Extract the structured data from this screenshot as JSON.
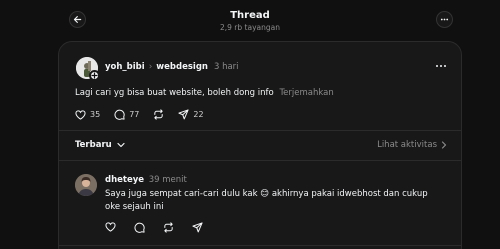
{
  "header": {
    "title": "Thread",
    "subtitle": "2,9 rb tayangan",
    "back_icon": "arrow-left-icon",
    "more_icon": "more-horizontal-icon"
  },
  "post": {
    "username": "yoh_bibi",
    "community": "webdesign",
    "time": "3 hari",
    "text": "Lagi cari yg bisa buat website, boleh dong info",
    "translate": "Terjemahkan",
    "likes": "35",
    "replies": "77",
    "shares": "22"
  },
  "sort": {
    "label": "Terbaru",
    "activity": "Lihat aktivitas"
  },
  "reply": {
    "username": "dheteye",
    "time": "39 menit",
    "text": "Saya juga sempat cari-cari dulu kak 😊 akhirnya pakai idwebhost dan cukup oke sejauh ini"
  }
}
